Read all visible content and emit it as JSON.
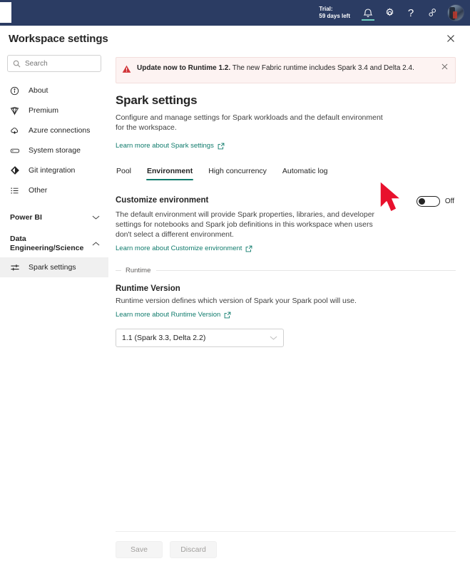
{
  "topbar": {
    "trial_line1": "Trial:",
    "trial_line2": "59 days left",
    "icons": {
      "notifications": "bell-icon",
      "settings": "gear-icon",
      "help": "?",
      "feedback": "feedback-icon",
      "avatar": "user-avatar"
    },
    "background_color": "#2b3c63"
  },
  "dialog": {
    "title": "Workspace settings",
    "close_label": "✕"
  },
  "sidebar": {
    "search": {
      "placeholder": "Search",
      "value": ""
    },
    "items": [
      {
        "label": "About",
        "icon": "info-icon"
      },
      {
        "label": "Premium",
        "icon": "diamond-icon"
      },
      {
        "label": "Azure connections",
        "icon": "cloud-icon"
      },
      {
        "label": "System storage",
        "icon": "storage-icon"
      },
      {
        "label": "Git integration",
        "icon": "git-icon"
      },
      {
        "label": "Other",
        "icon": "list-icon"
      }
    ],
    "groups": [
      {
        "label": "Power BI",
        "expanded": false,
        "items": []
      },
      {
        "label": "Data Engineering/Science",
        "expanded": true,
        "items": [
          {
            "label": "Spark settings",
            "icon": "sliders-icon",
            "selected": true
          }
        ]
      }
    ]
  },
  "banner": {
    "strong": "Update now to Runtime 1.2.",
    "rest": " The new Fabric runtime includes Spark 3.4 and Delta 2.4.",
    "icon": "warning-icon",
    "close_label": "✕",
    "background_color": "#fdf3f2",
    "icon_color": "#d13438"
  },
  "main": {
    "title": "Spark settings",
    "description": "Configure and manage settings for Spark workloads and the default environment for the workspace.",
    "learn_more": "Learn more about Spark settings",
    "tabs": [
      {
        "label": "Pool",
        "active": false
      },
      {
        "label": "Environment",
        "active": true
      },
      {
        "label": "High concurrency",
        "active": false
      },
      {
        "label": "Automatic log",
        "active": false
      }
    ],
    "accent_color": "#0f7b6c"
  },
  "customize_environment": {
    "title": "Customize environment",
    "description": "The default environment will provide Spark properties, libraries, and developer settings for notebooks and Spark job definitions in this workspace when users don't select a different environment.",
    "learn_more": "Learn more about Customize environment",
    "toggle_state": "Off"
  },
  "runtime_section": {
    "legend": "Runtime",
    "title": "Runtime Version",
    "description": "Runtime version defines which version of Spark your Spark pool will use.",
    "learn_more": "Learn more about Runtime Version",
    "dropdown_value": "1.1 (Spark 3.3, Delta 2.2)"
  },
  "footer": {
    "save_label": "Save",
    "discard_label": "Discard"
  }
}
